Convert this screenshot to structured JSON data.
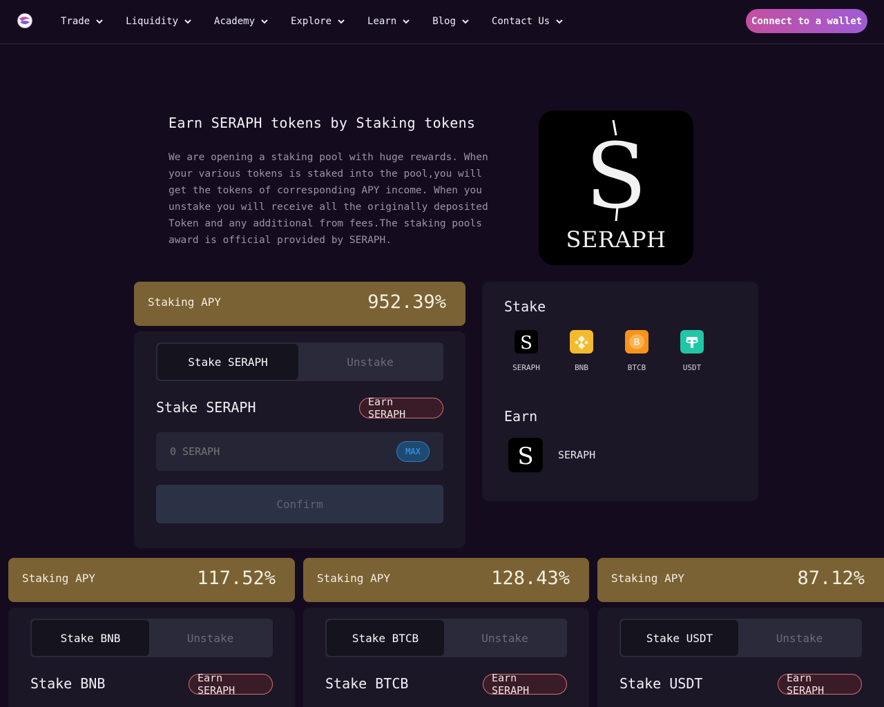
{
  "nav": {
    "items": [
      {
        "label": "Trade"
      },
      {
        "label": "Liquidity"
      },
      {
        "label": "Academy"
      },
      {
        "label": "Explore"
      },
      {
        "label": "Learn"
      },
      {
        "label": "Blog"
      },
      {
        "label": "Contact Us"
      }
    ],
    "connect_label": "Connect to a wallet"
  },
  "hero": {
    "title": "Earn SERAPH tokens by Staking tokens",
    "description": "We are opening a staking pool with huge rewards. When your various tokens is staked into the pool,you will get the tokens of corresponding APY income. When you unstake you will receive all the originally deposited Token and any additional from fees.The staking pools award is official provided by SERAPH.",
    "logo_text": "SERAPH"
  },
  "main_pool": {
    "apy_label": "Staking APY",
    "apy_value": "952.39%",
    "tab_stake": "Stake SERAPH",
    "tab_unstake": "Unstake",
    "stake_title": "Stake SERAPH",
    "earn_badge": "Earn SERAPH",
    "input_placeholder": "0 SERAPH",
    "max_label": "MAX",
    "confirm_label": "Confirm"
  },
  "panel": {
    "stake_heading": "Stake",
    "tokens": [
      {
        "name": "SERAPH",
        "color": "#000000"
      },
      {
        "name": "BNB",
        "color": "#f3ba2f"
      },
      {
        "name": "BTCB",
        "color": "#f7931a"
      },
      {
        "name": "USDT",
        "color": "#26a17b"
      }
    ],
    "earn_heading": "Earn",
    "earn_token": "SERAPH"
  },
  "pools": [
    {
      "apy_label": "Staking APY",
      "apy_value": "117.52%",
      "tab_stake": "Stake BNB",
      "tab_unstake": "Unstake",
      "stake_title": "Stake BNB",
      "earn_badge": "Earn SERAPH"
    },
    {
      "apy_label": "Staking APY",
      "apy_value": "128.43%",
      "tab_stake": "Stake BTCB",
      "tab_unstake": "Unstake",
      "stake_title": "Stake BTCB",
      "earn_badge": "Earn SERAPH"
    },
    {
      "apy_label": "Staking APY",
      "apy_value": "87.12%",
      "tab_stake": "Stake USDT",
      "tab_unstake": "Unstake",
      "stake_title": "Stake USDT",
      "earn_badge": "Earn SERAPH"
    }
  ],
  "colors": {
    "background": "#150b1e",
    "card": "#1b1726",
    "apy_bar": "#7a6234",
    "accent": "#c44fa0"
  }
}
